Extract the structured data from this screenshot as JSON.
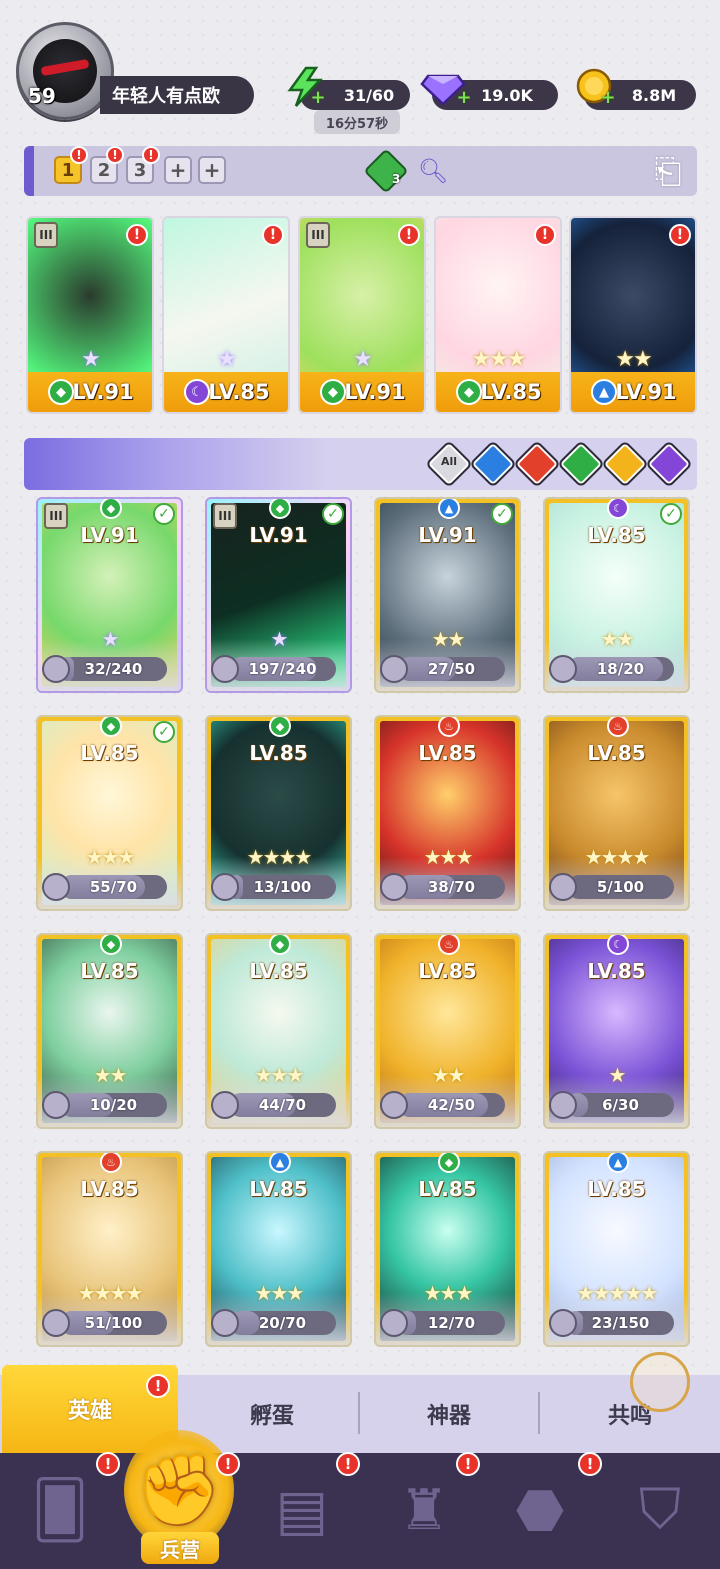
{
  "player": {
    "level": "59",
    "name": "年轻人有点欧"
  },
  "resources": {
    "energy": "31/60",
    "energy_timer": "16分57秒",
    "gems": "19.0K",
    "coins": "8.8M"
  },
  "team_tabs": [
    "1",
    "2",
    "3",
    "+",
    "+"
  ],
  "team_gem_count": "3",
  "team": [
    {
      "level": "LV.91",
      "element": "nature",
      "stars": "★",
      "star_style": "purple"
    },
    {
      "level": "LV.85",
      "element": "dark",
      "stars": "★",
      "star_style": "purple"
    },
    {
      "level": "LV.91",
      "element": "nature",
      "stars": "★",
      "star_style": "purple"
    },
    {
      "level": "LV.85",
      "element": "nature",
      "stars": "★★★",
      "star_style": "gold"
    },
    {
      "level": "LV.91",
      "element": "water",
      "stars": "★★",
      "star_style": "gold"
    }
  ],
  "filters": [
    "All",
    "water",
    "fire",
    "nature",
    "light",
    "dark"
  ],
  "filter_all_label": "All",
  "heroes": [
    {
      "level": "LV.91",
      "element": "nature",
      "progress": "32/240",
      "fraction": 0.13,
      "stars": "★",
      "checked": true,
      "style": "purple"
    },
    {
      "level": "LV.91",
      "element": "nature",
      "progress": "197/240",
      "fraction": 0.82,
      "stars": "★",
      "checked": true,
      "style": "purple"
    },
    {
      "level": "LV.91",
      "element": "water",
      "progress": "27/50",
      "fraction": 0.54,
      "stars": "★★",
      "checked": true,
      "style": "gold"
    },
    {
      "level": "LV.85",
      "element": "dark",
      "progress": "18/20",
      "fraction": 0.9,
      "stars": "★★",
      "checked": true,
      "style": "gold"
    },
    {
      "level": "LV.85",
      "element": "nature",
      "progress": "55/70",
      "fraction": 0.79,
      "stars": "★★★",
      "checked": true,
      "style": "gold"
    },
    {
      "level": "LV.85",
      "element": "nature",
      "progress": "13/100",
      "fraction": 0.13,
      "stars": "★★★★",
      "checked": false,
      "style": "gold"
    },
    {
      "level": "LV.85",
      "element": "fire",
      "progress": "38/70",
      "fraction": 0.54,
      "stars": "★★★",
      "checked": false,
      "style": "gold"
    },
    {
      "level": "LV.85",
      "element": "fire",
      "progress": "5/100",
      "fraction": 0.05,
      "stars": "★★★★",
      "checked": false,
      "style": "gold"
    },
    {
      "level": "LV.85",
      "element": "nature",
      "progress": "10/20",
      "fraction": 0.5,
      "stars": "★★",
      "checked": false,
      "style": "gold"
    },
    {
      "level": "LV.85",
      "element": "nature",
      "progress": "44/70",
      "fraction": 0.63,
      "stars": "★★★",
      "checked": false,
      "style": "gold"
    },
    {
      "level": "LV.85",
      "element": "fire",
      "progress": "42/50",
      "fraction": 0.84,
      "stars": "★★",
      "checked": false,
      "style": "gold"
    },
    {
      "level": "LV.85",
      "element": "dark",
      "progress": "6/30",
      "fraction": 0.2,
      "stars": "★",
      "checked": false,
      "style": "gold"
    },
    {
      "level": "LV.85",
      "element": "fire",
      "progress": "51/100",
      "fraction": 0.51,
      "stars": "★★★★",
      "checked": false,
      "style": "gold"
    },
    {
      "level": "LV.85",
      "element": "water",
      "progress": "20/70",
      "fraction": 0.29,
      "stars": "★★★",
      "checked": false,
      "style": "gold"
    },
    {
      "level": "LV.85",
      "element": "nature",
      "progress": "12/70",
      "fraction": 0.17,
      "stars": "★★★",
      "checked": false,
      "style": "gold"
    },
    {
      "level": "LV.85",
      "element": "water",
      "progress": "23/150",
      "fraction": 0.15,
      "stars": "★★★★★",
      "checked": false,
      "style": "gold"
    }
  ],
  "sub_tabs": [
    "英雄",
    "孵蛋",
    "神器",
    "共鸣"
  ],
  "bottom_nav": {
    "active_label": "兵营"
  },
  "colors": {
    "nature": "#2fae46",
    "water": "#2b7fe0",
    "fire": "#e2402a",
    "light": "#f2b31b",
    "dark": "#8346d6",
    "accent_gold": "#f6b614",
    "badge_red": "#e8332b"
  }
}
